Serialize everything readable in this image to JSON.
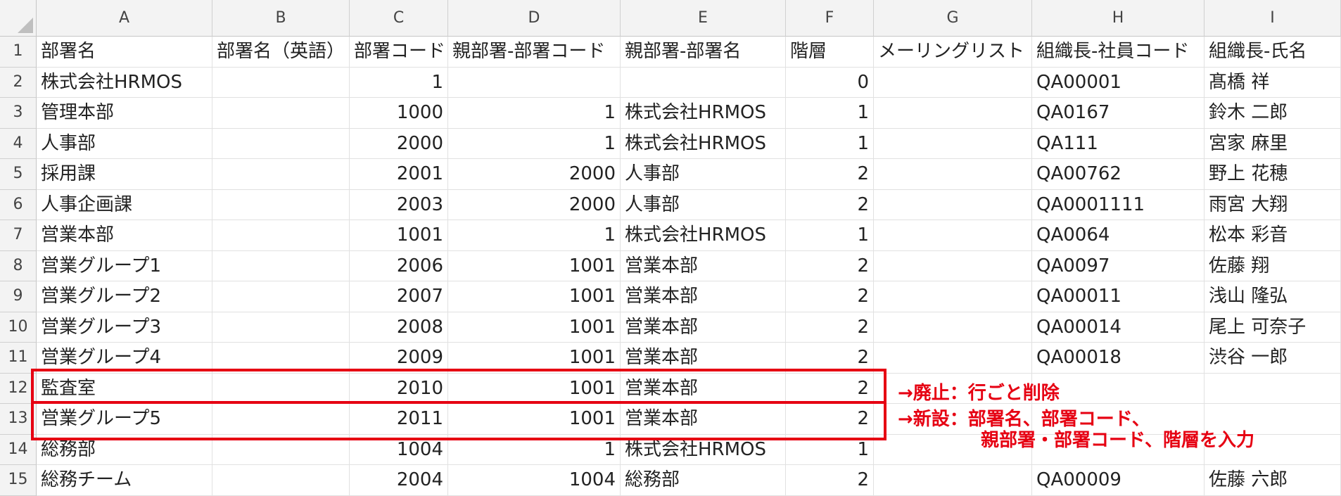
{
  "spreadsheet": {
    "columns": [
      "A",
      "B",
      "C",
      "D",
      "E",
      "F",
      "G",
      "H",
      "I"
    ],
    "headers": [
      "部署名",
      "部署名（英語）",
      "部署コード",
      "親部署-部署コード",
      "親部署-部署名",
      "階層",
      "メーリングリスト",
      "組織長-社員コード",
      "組織長-氏名"
    ],
    "rows": [
      {
        "num": "2",
        "cells": [
          "株式会社HRMOS",
          "",
          "1",
          "",
          "",
          "0",
          "",
          "QA00001",
          "髙橋 祥"
        ]
      },
      {
        "num": "3",
        "cells": [
          "管理本部",
          "",
          "1000",
          "1",
          "株式会社HRMOS",
          "1",
          "",
          "QA0167",
          "鈴木 二郎"
        ]
      },
      {
        "num": "4",
        "cells": [
          "人事部",
          "",
          "2000",
          "1",
          "株式会社HRMOS",
          "1",
          "",
          "QA111",
          "宮家 麻里"
        ]
      },
      {
        "num": "5",
        "cells": [
          "採用課",
          "",
          "2001",
          "2000",
          "人事部",
          "2",
          "",
          "QA00762",
          "野上 花穂"
        ]
      },
      {
        "num": "6",
        "cells": [
          "人事企画課",
          "",
          "2003",
          "2000",
          "人事部",
          "2",
          "",
          "QA0001111",
          "雨宮 大翔"
        ]
      },
      {
        "num": "7",
        "cells": [
          "営業本部",
          "",
          "1001",
          "1",
          "株式会社HRMOS",
          "1",
          "",
          "QA0064",
          "松本 彩音"
        ]
      },
      {
        "num": "8",
        "cells": [
          "営業グループ1",
          "",
          "2006",
          "1001",
          "営業本部",
          "2",
          "",
          "QA0097",
          "佐藤 翔"
        ]
      },
      {
        "num": "9",
        "cells": [
          "営業グループ2",
          "",
          "2007",
          "1001",
          "営業本部",
          "2",
          "",
          "QA00011",
          "浅山 隆弘"
        ]
      },
      {
        "num": "10",
        "cells": [
          "営業グループ3",
          "",
          "2008",
          "1001",
          "営業本部",
          "2",
          "",
          "QA00014",
          "尾上 可奈子"
        ]
      },
      {
        "num": "11",
        "cells": [
          "営業グループ4",
          "",
          "2009",
          "1001",
          "営業本部",
          "2",
          "",
          "QA00018",
          "渋谷 一郎"
        ]
      },
      {
        "num": "12",
        "cells": [
          "監査室",
          "",
          "2010",
          "1001",
          "営業本部",
          "2",
          "",
          "",
          ""
        ]
      },
      {
        "num": "13",
        "cells": [
          "営業グループ5",
          "",
          "2011",
          "1001",
          "営業本部",
          "2",
          "",
          "",
          ""
        ]
      },
      {
        "num": "14",
        "cells": [
          "総務部",
          "",
          "1004",
          "1",
          "株式会社HRMOS",
          "1",
          "",
          "",
          ""
        ]
      },
      {
        "num": "15",
        "cells": [
          "総務チーム",
          "",
          "2004",
          "1004",
          "総務部",
          "2",
          "",
          "QA00009",
          "佐藤 六郎"
        ]
      }
    ],
    "header_row_num": "1"
  },
  "annotations": {
    "line1": "→廃止：行ごと削除",
    "line2": "→新設：部署名、部署コード、",
    "line3": "親部署・部署コード、階層を入力",
    "color": "#e60012"
  }
}
